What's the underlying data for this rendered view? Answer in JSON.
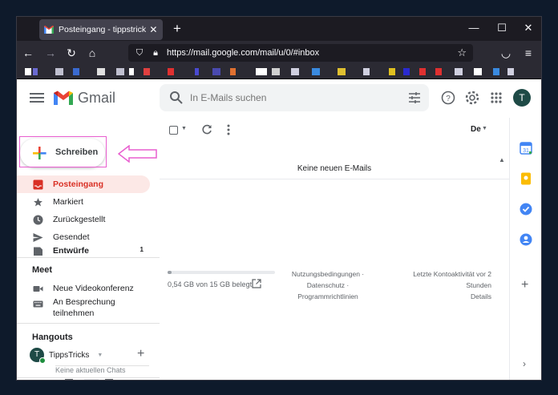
{
  "browser": {
    "tab_title": "Posteingang - tippstricks.test@",
    "url": "https://mail.google.com/mail/u/0/#inbox"
  },
  "gmail": {
    "app_name": "Gmail",
    "search_placeholder": "In E-Mails suchen",
    "avatar_letter": "T",
    "compose_label": "Schreiben",
    "nav": [
      {
        "label": "Posteingang",
        "icon": "inbox-icon",
        "active": true
      },
      {
        "label": "Markiert",
        "icon": "star-icon"
      },
      {
        "label": "Zurückgestellt",
        "icon": "clock-icon"
      },
      {
        "label": "Gesendet",
        "icon": "send-icon"
      },
      {
        "label": "Entwürfe",
        "icon": "draft-icon",
        "count": "1"
      }
    ],
    "meet": {
      "title": "Meet",
      "items": [
        "Neue Videokonferenz",
        "An Besprechung teilnehmen"
      ]
    },
    "hangouts": {
      "title": "Hangouts",
      "user": "TippsTricks",
      "user_letter": "T",
      "no_chats": "Keine aktuellen Chats"
    },
    "main": {
      "empty_message": "Keine neuen E-Mails",
      "storage_text": "0,54 GB von 15 GB belegt",
      "storage_fraction": 0.036,
      "footer_links": [
        "Nutzungsbedingungen ·",
        "Datenschutz ·",
        "Programmrichtlinien"
      ],
      "activity": [
        "Letzte Kontoaktivität vor 2",
        "Stunden",
        "Details"
      ]
    },
    "accent_color": "#d93025",
    "annotation_color": "#e85ecf"
  }
}
